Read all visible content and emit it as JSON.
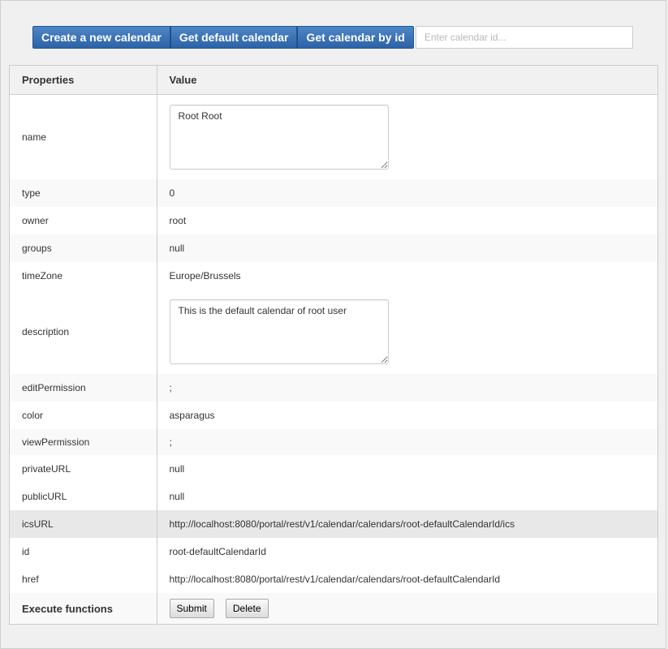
{
  "toolbar": {
    "create_label": "Create a new calendar",
    "get_default_label": "Get default calendar",
    "get_by_id_label": "Get calendar by id",
    "id_placeholder": "Enter calendar id..."
  },
  "table": {
    "col_properties": "Properties",
    "col_value": "Value",
    "rows": [
      {
        "key": "name",
        "value": "Root Root"
      },
      {
        "key": "type",
        "value": "0"
      },
      {
        "key": "owner",
        "value": "root"
      },
      {
        "key": "groups",
        "value": "null"
      },
      {
        "key": "timeZone",
        "value": "Europe/Brussels"
      },
      {
        "key": "description",
        "value": "This is the default calendar of root user"
      },
      {
        "key": "editPermission",
        "value": ";"
      },
      {
        "key": "color",
        "value": "asparagus"
      },
      {
        "key": "viewPermission",
        "value": ";"
      },
      {
        "key": "privateURL",
        "value": "null"
      },
      {
        "key": "publicURL",
        "value": "null"
      },
      {
        "key": "icsURL",
        "value": "http://localhost:8080/portal/rest/v1/calendar/calendars/root-defaultCalendarId/ics"
      },
      {
        "key": "id",
        "value": "root-defaultCalendarId"
      },
      {
        "key": "href",
        "value": "http://localhost:8080/portal/rest/v1/calendar/calendars/root-defaultCalendarId"
      }
    ]
  },
  "execute": {
    "label": "Execute functions",
    "submit_label": "Submit",
    "delete_label": "Delete"
  }
}
